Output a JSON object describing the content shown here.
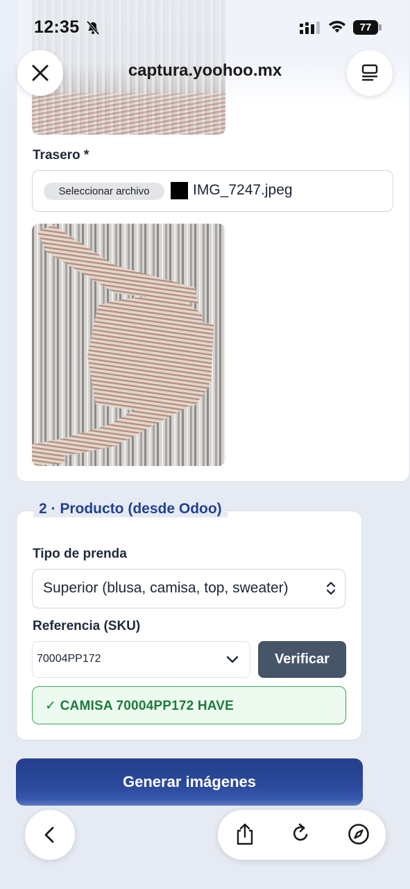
{
  "status_bar": {
    "time": "12:35",
    "battery": "77",
    "icons": [
      "bell-slash-icon",
      "cellular-signal-icon",
      "wifi-icon",
      "battery-icon"
    ]
  },
  "browser": {
    "url": "captura.yoohoo.mx",
    "close_icon": "close-icon",
    "reader_icon": "reader-mode-icon",
    "toolbar_icons": [
      "back-icon",
      "share-icon",
      "reload-icon",
      "compass-icon"
    ]
  },
  "trasero": {
    "label": "Trasero *",
    "file_button": "Seleccionar archivo",
    "file_name": "IMG_7247.jpeg"
  },
  "producto": {
    "legend": "2 · Producto (desde Odoo)",
    "tipo_label": "Tipo de prenda",
    "tipo_value": "Superior (blusa, camisa, top, sweater)",
    "sku_label": "Referencia (SKU)",
    "sku_value": "70004PP172",
    "verify_button": "Verificar",
    "verified_message": "✓ CAMISA 70004PP172 HAVE"
  },
  "generate_button": "Generar imágenes",
  "colors": {
    "accent": "#22418f",
    "success": "#1e7a3c",
    "button_dark": "#475569"
  }
}
